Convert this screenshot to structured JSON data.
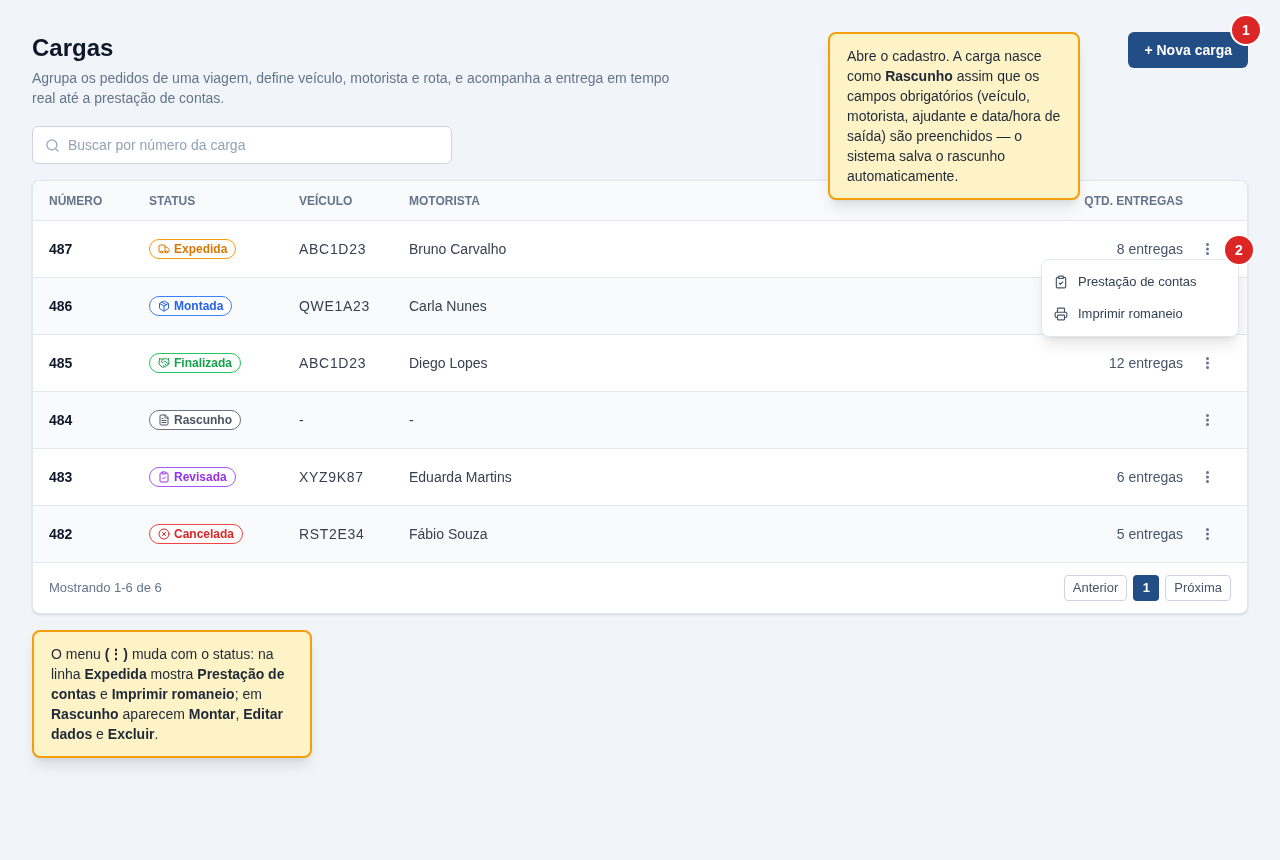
{
  "page": {
    "title": "Cargas",
    "subtitle": "Agrupa os pedidos de uma viagem, define veículo, motorista e rota, e acompanha a entrega em tempo real até a prestação de contas.",
    "new_button": "+ Nova carga",
    "new_button_marker": "1"
  },
  "search": {
    "placeholder": "Buscar por número da carga"
  },
  "callout_top": "Abre o cadastro. A carga nasce como **Rascunho** assim que os campos obrigatórios (veículo, motorista, ajudante e data/hora de saída) são preenchidos — o sistema salva o rascunho automaticamente.",
  "table": {
    "columns": [
      "NÚMERO",
      "STATUS",
      "VEÍCULO",
      "MOTORISTA",
      "QTD. ENTREGAS"
    ],
    "rows": [
      {
        "number": "487",
        "status": {
          "label": "Expedida",
          "kind": "expedida"
        },
        "vehicle": "ABC1D23",
        "driver": "Bruno Carvalho",
        "deliveries": "8 entregas",
        "menu": {
          "marker": "2",
          "items": [
            {
              "label": "Prestação de contas",
              "kind": "accounts"
            },
            {
              "label": "Imprimir romaneio",
              "kind": "print"
            }
          ]
        }
      },
      {
        "number": "486",
        "status": {
          "label": "Montada",
          "kind": "montada"
        },
        "vehicle": "QWE1A23",
        "driver": "Carla Nunes"
      },
      {
        "number": "485",
        "status": {
          "label": "Finalizada",
          "kind": "finalizada"
        },
        "vehicle": "ABC1D23",
        "driver": "Diego Lopes",
        "deliveries": "12 entregas"
      },
      {
        "number": "484",
        "status": {
          "label": "Rascunho",
          "kind": "rascunho"
        },
        "vehicle": "-",
        "driver": "-"
      },
      {
        "number": "483",
        "status": {
          "label": "Revisada",
          "kind": "revisada"
        },
        "vehicle": "XYZ9K87",
        "driver": "Eduarda Martins",
        "deliveries": "6 entregas"
      },
      {
        "number": "482",
        "status": {
          "label": "Cancelada",
          "kind": "cancelada"
        },
        "vehicle": "RST2E34",
        "driver": "Fábio Souza",
        "deliveries": "5 entregas"
      }
    ]
  },
  "footer": {
    "summary": "Mostrando 1-6 de 6",
    "prev": "Anterior",
    "pages": [
      {
        "label": "1",
        "selected": true
      }
    ],
    "next": "Próxima"
  },
  "callout_bottom": "O menu **(⋮)** muda com o status: na linha **Expedida** mostra **Prestação de contas** e **Imprimir romaneio**; em **Rascunho** aparecem **Montar**, **Editar dados** e **Excluir**."
}
